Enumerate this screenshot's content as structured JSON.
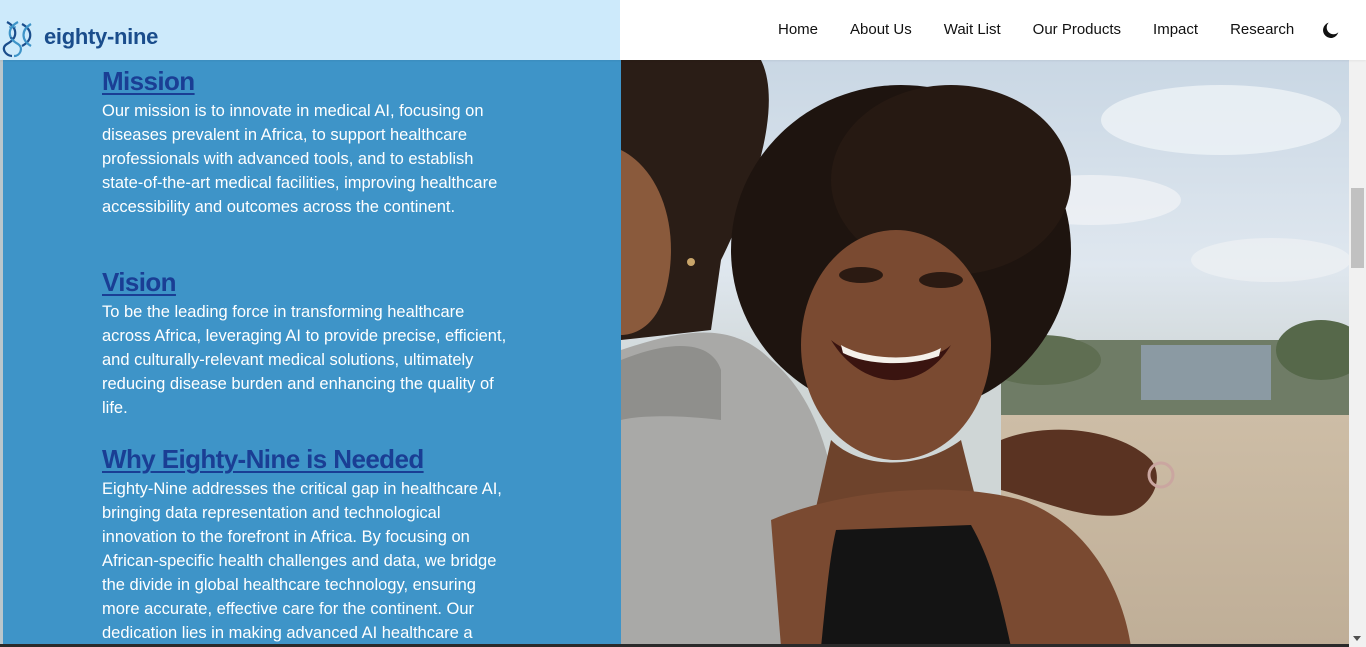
{
  "brand": {
    "name": "eighty-nine",
    "icon": "dna-icon",
    "header_bg": "#cdeafb",
    "text_color": "#1a4d8c"
  },
  "nav": {
    "items": [
      "Home",
      "About Us",
      "Wait List",
      "Our Products",
      "Impact",
      "Research"
    ],
    "theme_toggle_icon": "moon-icon"
  },
  "colors": {
    "panel_bg": "#3e94c8",
    "heading": "#1a3e94",
    "body_text": "#ffffff"
  },
  "sections": [
    {
      "heading": "Mission",
      "text": "Our mission is to innovate in medical AI, focusing on diseases prevalent in Africa, to support healthcare professionals with advanced tools, and to establish state-of-the-art medical facilities, improving healthcare accessibility and outcomes across the continent."
    },
    {
      "heading": "Vision",
      "text": "To be the leading force in transforming healthcare across Africa, leveraging AI to provide precise, efficient, and culturally-relevant medical solutions, ultimately reducing disease burden and enhancing the quality of life."
    },
    {
      "heading": "Why Eighty-Nine is Needed",
      "text": "Eighty-Nine addresses the critical gap in healthcare AI, bringing data representation and technological innovation to the forefront in Africa. By focusing on African-specific health challenges and data, we bridge the divide in global healthcare technology, ensuring more accurate, effective care for the continent. Our dedication lies in making advanced AI healthcare a"
    }
  ]
}
